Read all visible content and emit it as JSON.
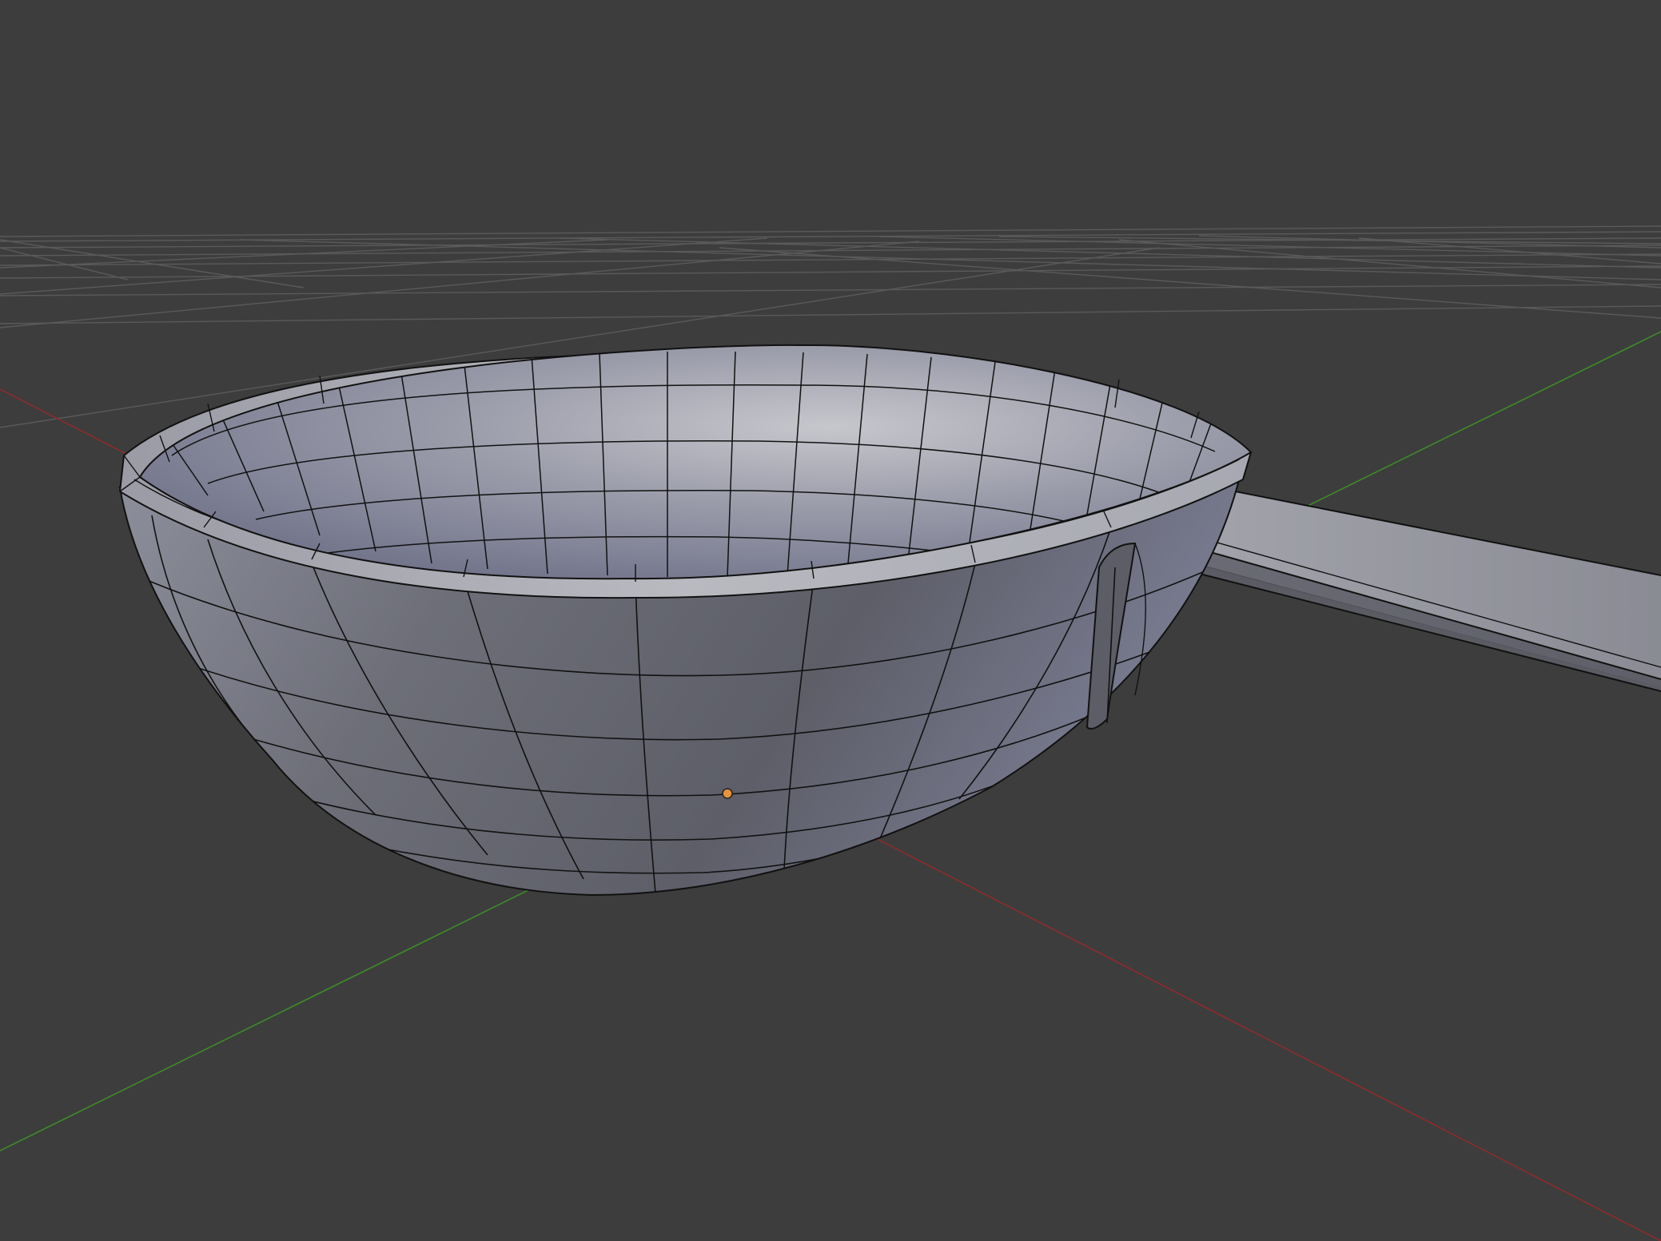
{
  "viewport": {
    "mode": "3d-viewport-perspective",
    "background_color": "#3d3d3d",
    "grid_color": "#5a5a5a",
    "x_axis_color": "#8e2b2b",
    "y_axis_color": "#3f8a2b"
  },
  "object": {
    "kind": "ladle-mesh",
    "shading": "solid",
    "wireframe_overlay": true,
    "wire_color": "#111111",
    "origin_color": "#e8923c"
  }
}
